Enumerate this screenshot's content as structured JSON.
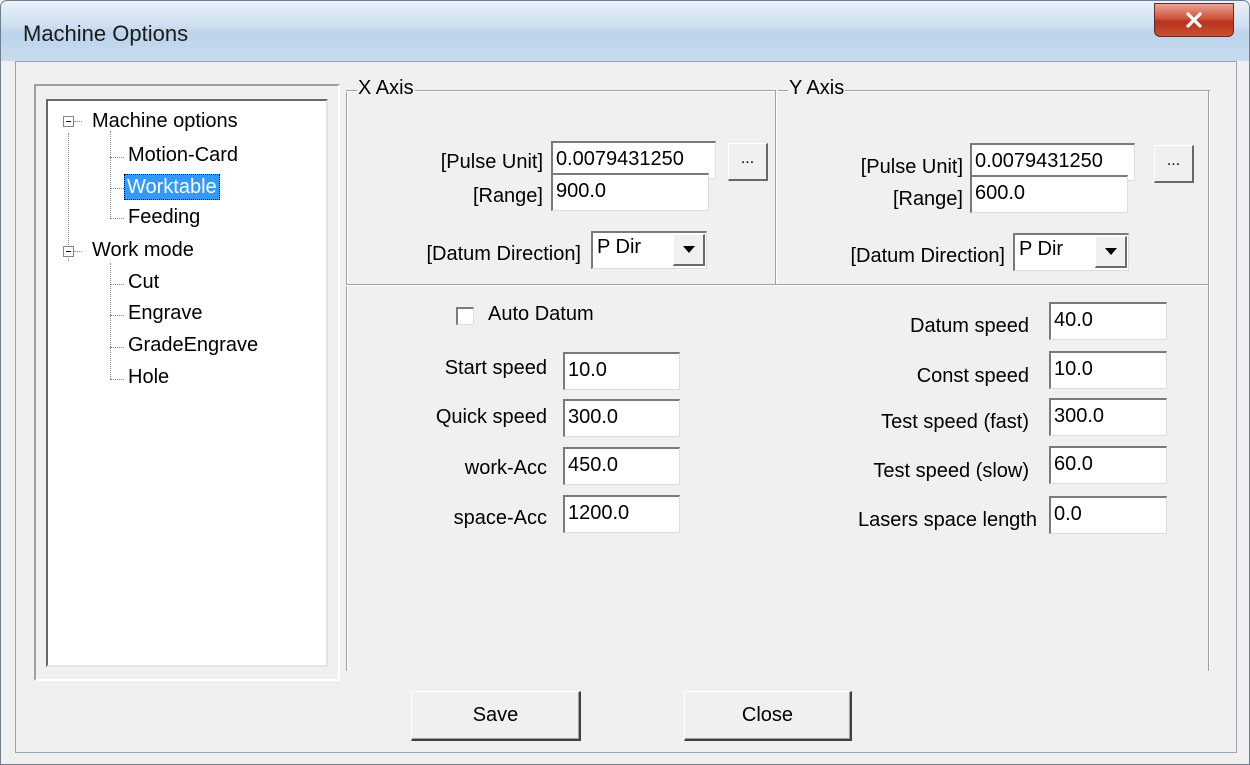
{
  "window": {
    "title": "Machine Options"
  },
  "tree": {
    "groups": [
      {
        "label": "Machine options",
        "children": [
          "Motion-Card",
          "Worktable",
          "Feeding"
        ]
      },
      {
        "label": "Work mode",
        "children": [
          "Cut",
          "Engrave",
          "GradeEngrave",
          "Hole"
        ]
      }
    ],
    "selected": "Worktable"
  },
  "x_axis": {
    "title": "X Axis",
    "pulse_unit_label": "[Pulse Unit]",
    "pulse_unit": "0.0079431250",
    "browse_label": "...",
    "range_label": "[Range]",
    "range": "900.0",
    "datum_dir_label": "[Datum Direction]",
    "datum_dir": "P Dir"
  },
  "y_axis": {
    "title": "Y Axis",
    "pulse_unit_label": "[Pulse Unit]",
    "pulse_unit": "0.0079431250",
    "browse_label": "...",
    "range_label": "[Range]",
    "range": "600.0",
    "datum_dir_label": "[Datum Direction]",
    "datum_dir": "P Dir"
  },
  "speeds": {
    "auto_datum_label": "Auto Datum",
    "auto_datum_checked": false,
    "left": [
      {
        "label": "Start speed",
        "value": "10.0"
      },
      {
        "label": "Quick speed",
        "value": "300.0"
      },
      {
        "label": "work-Acc",
        "value": "450.0"
      },
      {
        "label": "space-Acc",
        "value": "1200.0"
      }
    ],
    "right": [
      {
        "label": "Datum speed",
        "value": "40.0"
      },
      {
        "label": "Const speed",
        "value": "10.0"
      },
      {
        "label": "Test speed (fast)",
        "value": "300.0"
      },
      {
        "label": "Test speed (slow)",
        "value": "60.0"
      },
      {
        "label": "Lasers space length",
        "value": "0.0"
      }
    ]
  },
  "buttons": {
    "save": "Save",
    "close": "Close"
  },
  "icons": {
    "close": "close-x-icon",
    "dropdown": "chevron-down-icon",
    "collapse": "minus-box-icon"
  }
}
